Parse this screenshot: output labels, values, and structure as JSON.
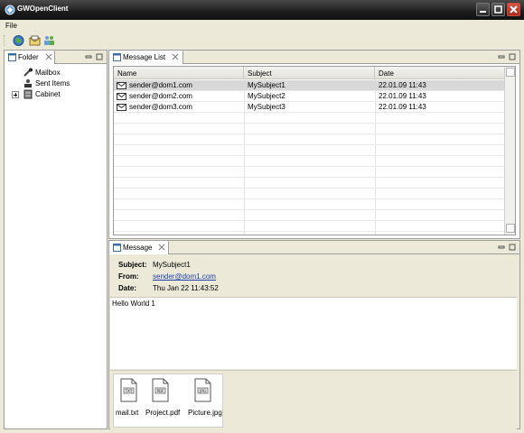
{
  "window": {
    "title": "GWOpenClient"
  },
  "menu": {
    "file": "File"
  },
  "toolbar": {
    "buttons": [
      "globe-icon",
      "mailbox-icon",
      "users-icon"
    ]
  },
  "folder_view": {
    "tab_label": "Folder",
    "items": [
      {
        "label": "Mailbox",
        "icon": "mailbox-icon"
      },
      {
        "label": "Sent Items",
        "icon": "sent-items-icon"
      },
      {
        "label": "Cabinet",
        "icon": "cabinet-icon"
      }
    ]
  },
  "message_list": {
    "tab_label": "Message List",
    "columns": [
      "Name",
      "Subject",
      "Date"
    ],
    "rows": [
      {
        "name": "sender@dom1.com",
        "subject": "MySubject1",
        "date": "22.01.09 11:43",
        "selected": true
      },
      {
        "name": "sender@dom2.com",
        "subject": "MySubject2",
        "date": "22.01.09 11:43",
        "selected": false
      },
      {
        "name": "sender@dom3.com",
        "subject": "MySubject3",
        "date": "22.01.09 11:43",
        "selected": false
      }
    ]
  },
  "message_view": {
    "tab_label": "Message",
    "subject_key": "Subject:",
    "subject": "MySubject1",
    "from_key": "From:",
    "from": "sender@dom1.com",
    "date_key": "Date:",
    "date": "Thu Jan 22 11:43:52",
    "body": "Hello World 1",
    "attachments": [
      {
        "name": "mail.txt",
        "icon": "text-file-icon"
      },
      {
        "name": "Project.pdf",
        "icon": "pdf-file-icon"
      },
      {
        "name": "Picture.jpg",
        "icon": "image-file-icon"
      }
    ]
  },
  "colors": {
    "titlebar": "#1c1c1c",
    "chrome": "#ece9d8",
    "selection": "#d8d8d8",
    "link": "#1c3fa8"
  }
}
